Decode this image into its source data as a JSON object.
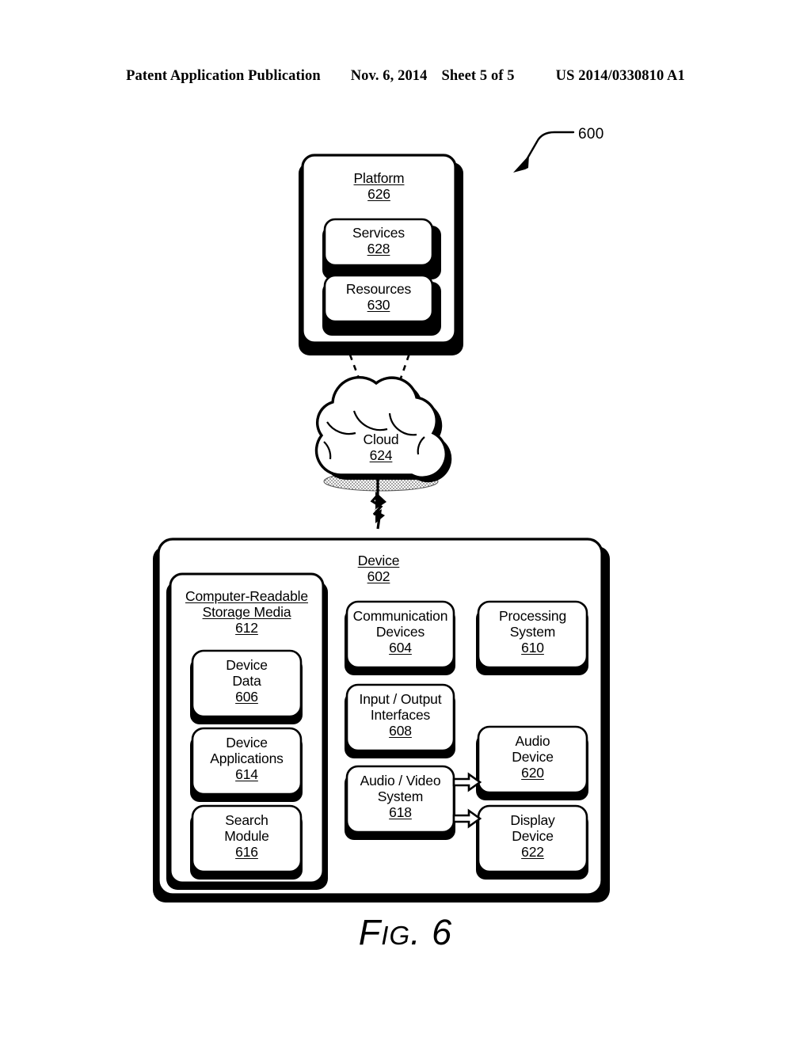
{
  "header": {
    "publication": "Patent Application Publication",
    "date": "Nov. 6, 2014",
    "sheet": "Sheet 5 of 5",
    "number": "US 2014/0330810 A1"
  },
  "figure": {
    "caption_fig": "F",
    "caption_ig": "IG",
    "caption_dot": ". ",
    "caption_number": "6",
    "caption_full": "FIG. 6",
    "system_ref": "600"
  },
  "diagram": {
    "platform": {
      "title": "Platform",
      "ref": "626",
      "children": [
        {
          "title": "Services",
          "ref": "628"
        },
        {
          "title": "Resources",
          "ref": "630"
        }
      ]
    },
    "cloud": {
      "title": "Cloud",
      "ref": "624"
    },
    "device": {
      "title": "Device",
      "ref": "602",
      "storage": {
        "title_line1": "Computer-Readable",
        "title_line2": "Storage Media",
        "ref": "612",
        "children": [
          {
            "line1": "Device",
            "line2": "Data",
            "ref": "606"
          },
          {
            "line1": "Device",
            "line2": "Applications",
            "ref": "614"
          },
          {
            "line1": "Search",
            "line2": "Module",
            "ref": "616"
          }
        ]
      },
      "middle_column": [
        {
          "line1": "Communication",
          "line2": "Devices",
          "ref": "604"
        },
        {
          "line1": "Input / Output",
          "line2": "Interfaces",
          "ref": "608"
        },
        {
          "line1": "Audio / Video",
          "line2": "System",
          "ref": "618"
        }
      ],
      "right_column": [
        {
          "line1": "Processing",
          "line2": "System",
          "ref": "610"
        },
        {
          "line1": "Audio",
          "line2": "Device",
          "ref": "620"
        },
        {
          "line1": "Display",
          "line2": "Device",
          "ref": "622"
        }
      ]
    },
    "connectors": {
      "platform_to_cloud": "dashed-lines",
      "cloud_to_device": "lightning-bolt",
      "av_to_audio": "hollow-arrow",
      "av_to_display": "hollow-arrow"
    },
    "colors": {
      "stroke": "#000000",
      "fill": "#ffffff",
      "shadow": "#000000"
    }
  }
}
